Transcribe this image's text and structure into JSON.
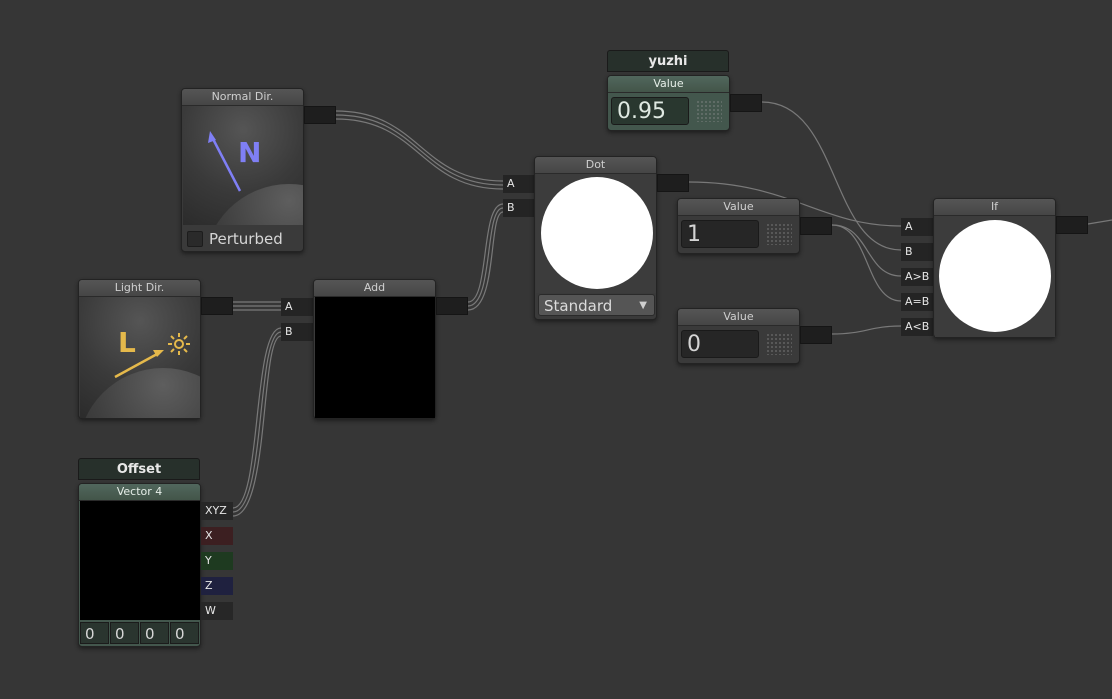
{
  "nodes": {
    "normal_dir": {
      "title": "Normal Dir.",
      "glyph": "N",
      "checkbox_label": "Perturbed",
      "checked": false
    },
    "light_dir": {
      "title": "Light Dir.",
      "glyph": "L"
    },
    "add": {
      "title": "Add",
      "inputs": [
        "A",
        "B"
      ]
    },
    "dot": {
      "title": "Dot",
      "inputs": [
        "A",
        "B"
      ],
      "mode": "Standard"
    },
    "yuzhi": {
      "property_name": "yuzhi",
      "title": "Value",
      "value": "0.95"
    },
    "value_1": {
      "title": "Value",
      "value": "1"
    },
    "value_0": {
      "title": "Value",
      "value": "0"
    },
    "if_node": {
      "title": "If",
      "inputs": [
        "A",
        "B",
        "A>B",
        "A=B",
        "A<B"
      ]
    },
    "offset": {
      "property_name": "Offset",
      "title": "Vector 4",
      "outputs": [
        "XYZ",
        "X",
        "Y",
        "Z",
        "W"
      ],
      "values": [
        "0",
        "0",
        "0",
        "0"
      ]
    }
  },
  "colors": {
    "canvas": "#363636",
    "node_body": "#3a3a3a",
    "property_green": "#43574d",
    "normal_glyph": "#7f7ff5",
    "light_glyph": "#e5b94b",
    "port_red": "#3c1f21",
    "port_green": "#1e3a20",
    "port_blue": "#1f213f"
  },
  "icons": {
    "normal_arrow": "arrow-icon",
    "light_arrow": "arrow-icon",
    "sun": "sun-icon",
    "dropdown": "chevron-down-icon"
  }
}
